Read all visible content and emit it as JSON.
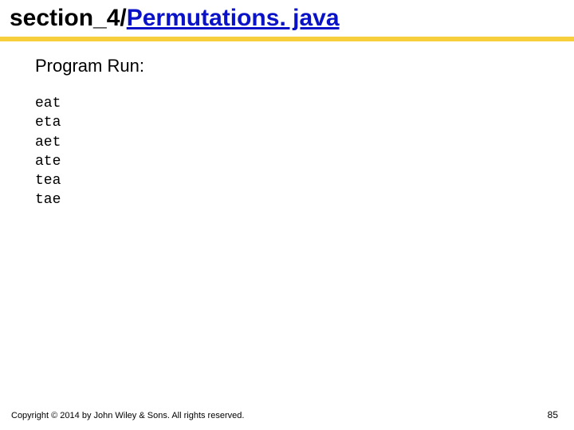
{
  "title": {
    "prefix": "section_4/",
    "link_text": "Permutations. java"
  },
  "body": {
    "subhead": "Program Run:",
    "output_lines": [
      "eat",
      "eta",
      "aet",
      "ate",
      "tea",
      "tae"
    ],
    "output_text": "eat\neta\naet\nate\ntea\ntae"
  },
  "footer": {
    "copyright": "Copyright © 2014 by John Wiley & Sons. All rights reserved.",
    "page": "85"
  },
  "colors": {
    "accent_rule": "#f7cf3c",
    "link": "#0a12c8"
  }
}
